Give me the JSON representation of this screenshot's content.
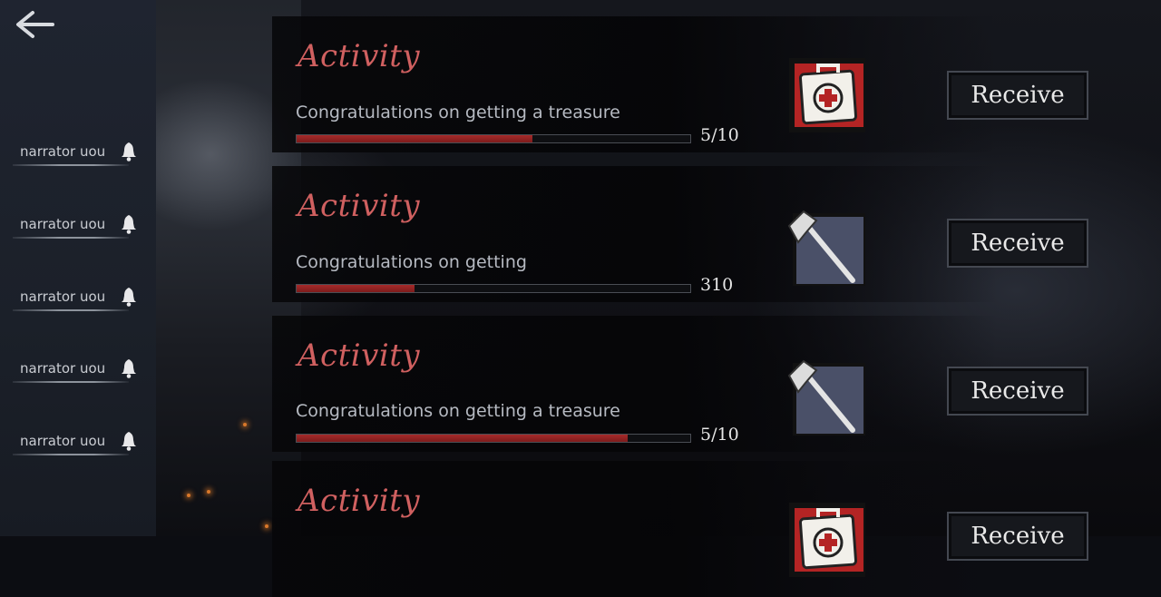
{
  "sidebar": {
    "back_icon": "back-arrow-icon",
    "items": [
      {
        "label": "narrator   uou",
        "icon": "bell-icon"
      },
      {
        "label": "narrator   uou",
        "icon": "bell-icon"
      },
      {
        "label": "narrator   uou",
        "icon": "bell-icon"
      },
      {
        "label": "narrator   uou",
        "icon": "bell-icon"
      },
      {
        "label": "narrator   uou",
        "icon": "bell-icon"
      }
    ]
  },
  "activities": [
    {
      "title": "Activity",
      "description": "Congratulations on getting a treasure",
      "progress": 0.6,
      "count": "5/10",
      "reward_icon": "first-aid-kit-icon",
      "button": "Receive"
    },
    {
      "title": "Activity",
      "description": "Congratulations on getting",
      "progress": 0.3,
      "count": "310",
      "reward_icon": "hatchet-icon",
      "button": "Receive"
    },
    {
      "title": "Activity",
      "description": "Congratulations on getting a treasure",
      "progress": 0.84,
      "count": "5/10",
      "reward_icon": "hatchet-icon",
      "button": "Receive"
    },
    {
      "title": "Activity",
      "description": "",
      "progress": 0,
      "count": "",
      "reward_icon": "first-aid-kit-icon",
      "button": "Receive"
    }
  ],
  "colors": {
    "accent_red": "#d06060",
    "progress_red": "#a62a2a"
  }
}
